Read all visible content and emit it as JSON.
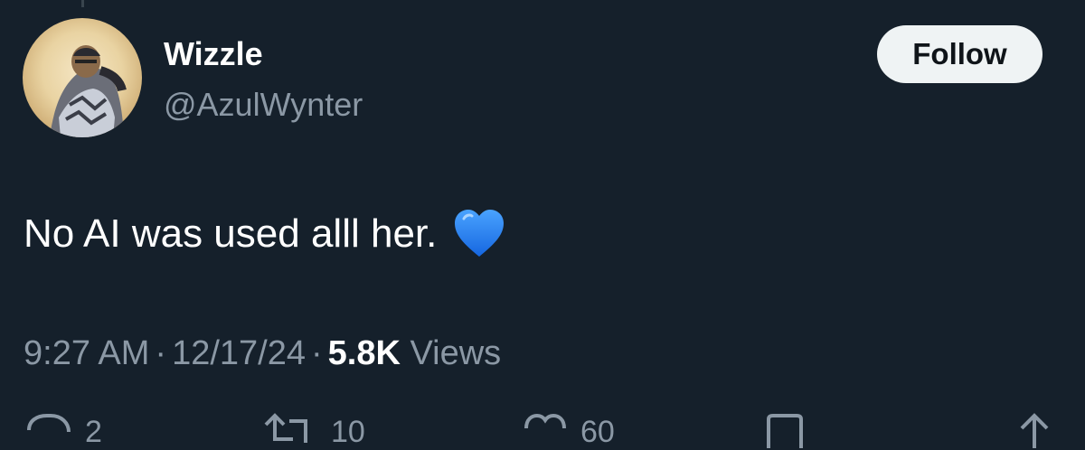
{
  "tweet": {
    "display_name": "Wizzle",
    "handle": "@AzulWynter",
    "follow_label": "Follow",
    "text": "No AI was used alll her.",
    "emoji": "blue-heart",
    "time": "9:27 AM",
    "date": "12/17/24",
    "separator": "·",
    "views_count": "5.8K",
    "views_label": "Views"
  },
  "actions": {
    "reply_count": "2",
    "repost_count": "10",
    "like_count": "60"
  },
  "colors": {
    "background": "#15202b",
    "secondary_text": "#8b98a5",
    "heart": "#1d7bf5"
  }
}
